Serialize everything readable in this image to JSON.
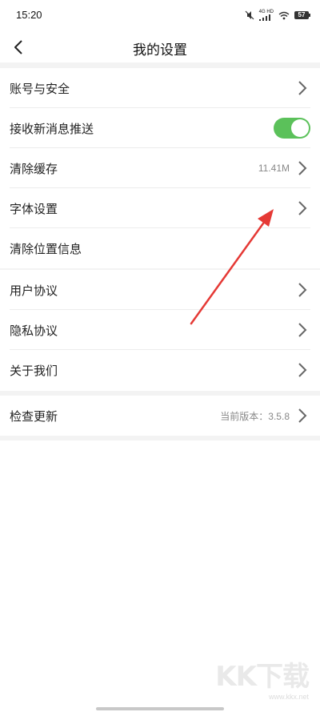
{
  "status_bar": {
    "time": "15:20",
    "network": "4G HD",
    "battery": "57"
  },
  "header": {
    "title": "我的设置"
  },
  "groups": [
    {
      "items": [
        {
          "label": "账号与安全",
          "value": ""
        },
        {
          "label": "接收新消息推送",
          "toggle": true
        },
        {
          "label": "清除缓存",
          "value": "11.41M"
        },
        {
          "label": "字体设置",
          "value": ""
        },
        {
          "label": "清除位置信息"
        }
      ]
    },
    {
      "items": [
        {
          "label": "用户协议"
        },
        {
          "label": "隐私协议"
        },
        {
          "label": "关于我们"
        }
      ]
    },
    {
      "items": [
        {
          "label": "检查更新",
          "value": "当前版本：3.5.8"
        }
      ]
    }
  ],
  "watermark": {
    "text": "KK下载",
    "url": "www.kkx.net"
  },
  "colors": {
    "toggle_on": "#5bc15a",
    "group_gap": "#f3f3f3",
    "annotation_arrow": "#e53935"
  }
}
